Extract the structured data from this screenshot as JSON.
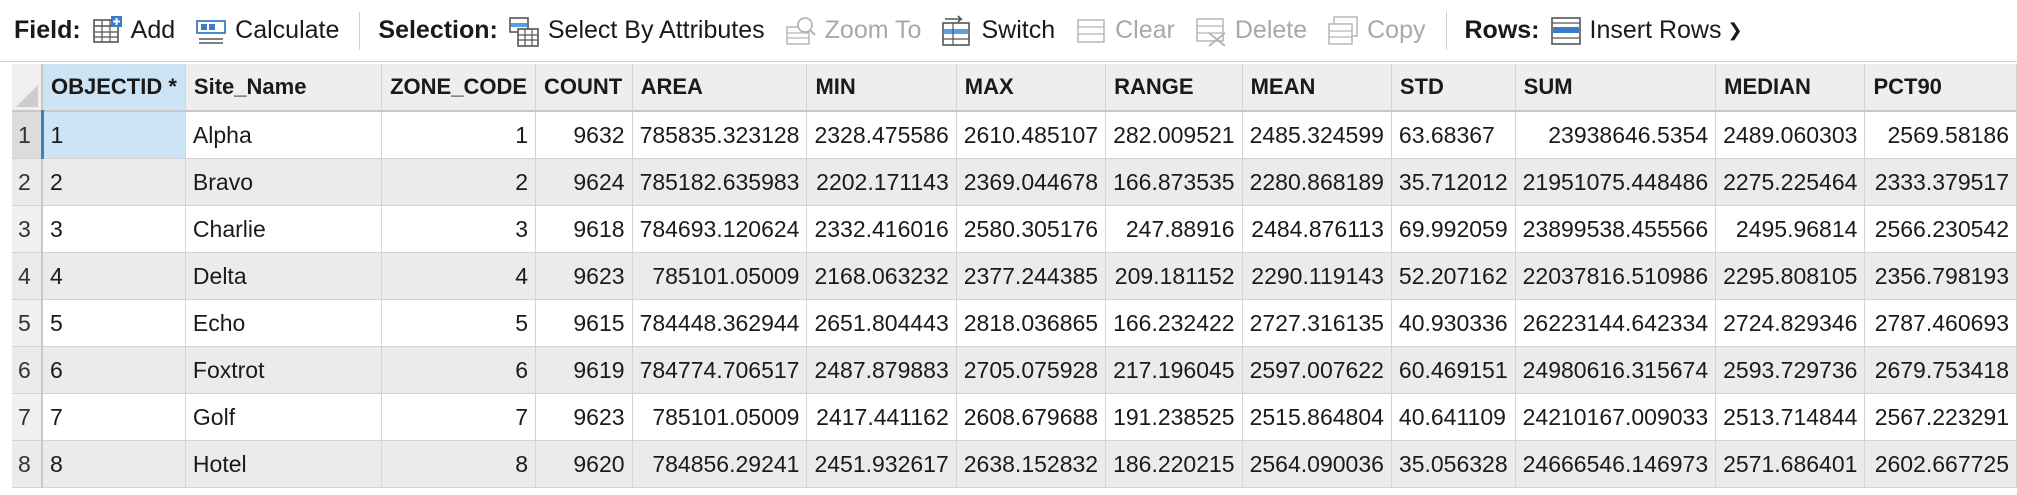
{
  "toolbar": {
    "field_label": "Field:",
    "add_label": "Add",
    "calculate_label": "Calculate",
    "selection_label": "Selection:",
    "select_by_attributes_label": "Select By Attributes",
    "zoom_to_label": "Zoom To",
    "switch_label": "Switch",
    "clear_label": "Clear",
    "delete_label": "Delete",
    "copy_label": "Copy",
    "rows_label": "Rows:",
    "insert_rows_label": "Insert Rows"
  },
  "columns": [
    "OBJECTID *",
    "Site_Name",
    "ZONE_CODE",
    "COUNT",
    "AREA",
    "MIN",
    "MAX",
    "RANGE",
    "MEAN",
    "STD",
    "SUM",
    "MEDIAN",
    "PCT90"
  ],
  "rows": [
    {
      "n": "1",
      "cells": [
        "1",
        "Alpha",
        "1",
        "9632",
        "785835.323128",
        "2328.475586",
        "2610.485107",
        "282.009521",
        "2485.324599",
        "63.68367",
        "23938646.5354",
        "2489.060303",
        "2569.58186"
      ]
    },
    {
      "n": "2",
      "cells": [
        "2",
        "Bravo",
        "2",
        "9624",
        "785182.635983",
        "2202.171143",
        "2369.044678",
        "166.873535",
        "2280.868189",
        "35.712012",
        "21951075.448486",
        "2275.225464",
        "2333.379517"
      ]
    },
    {
      "n": "3",
      "cells": [
        "3",
        "Charlie",
        "3",
        "9618",
        "784693.120624",
        "2332.416016",
        "2580.305176",
        "247.88916",
        "2484.876113",
        "69.992059",
        "23899538.455566",
        "2495.96814",
        "2566.230542"
      ]
    },
    {
      "n": "4",
      "cells": [
        "4",
        "Delta",
        "4",
        "9623",
        "785101.05009",
        "2168.063232",
        "2377.244385",
        "209.181152",
        "2290.119143",
        "52.207162",
        "22037816.510986",
        "2295.808105",
        "2356.798193"
      ]
    },
    {
      "n": "5",
      "cells": [
        "5",
        "Echo",
        "5",
        "9615",
        "784448.362944",
        "2651.804443",
        "2818.036865",
        "166.232422",
        "2727.316135",
        "40.930336",
        "26223144.642334",
        "2724.829346",
        "2787.460693"
      ]
    },
    {
      "n": "6",
      "cells": [
        "6",
        "Foxtrot",
        "6",
        "9619",
        "784774.706517",
        "2487.879883",
        "2705.075928",
        "217.196045",
        "2597.007622",
        "60.469151",
        "24980616.315674",
        "2593.729736",
        "2679.753418"
      ]
    },
    {
      "n": "7",
      "cells": [
        "7",
        "Golf",
        "7",
        "9623",
        "785101.05009",
        "2417.441162",
        "2608.679688",
        "191.238525",
        "2515.864804",
        "40.641109",
        "24210167.009033",
        "2513.714844",
        "2567.223291"
      ]
    },
    {
      "n": "8",
      "cells": [
        "8",
        "Hotel",
        "8",
        "9620",
        "784856.29241",
        "2451.932617",
        "2638.152832",
        "186.220215",
        "2564.090036",
        "35.056328",
        "24666546.146973",
        "2571.686401",
        "2602.667725"
      ]
    }
  ],
  "colors": {
    "selection": "#cde4f5",
    "accent": "#3a7cc7"
  }
}
